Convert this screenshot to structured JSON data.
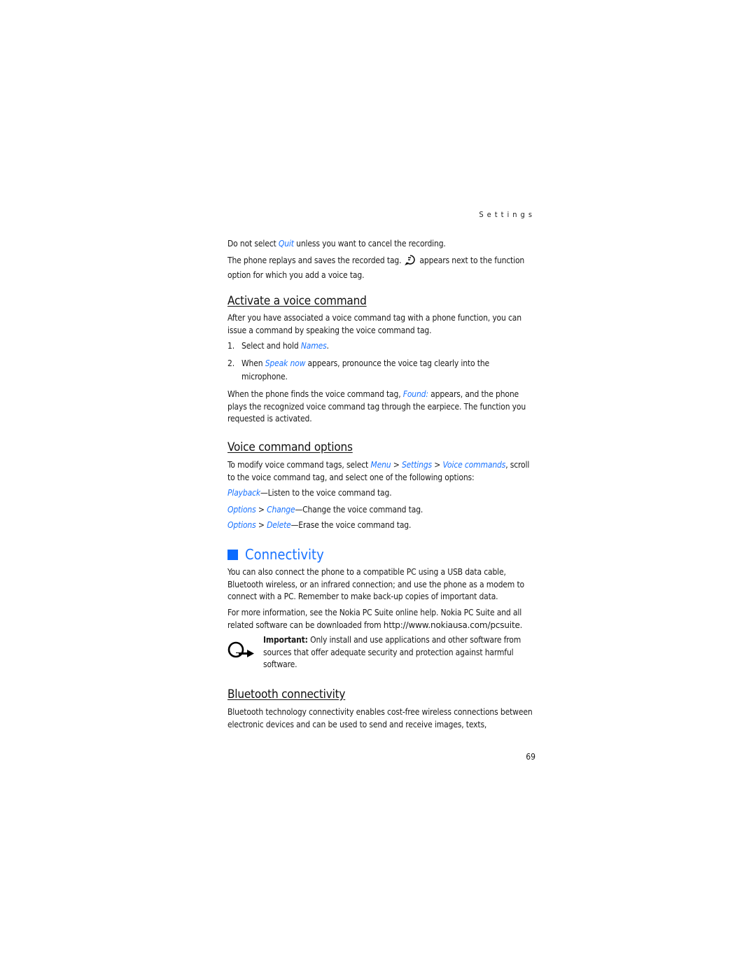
{
  "header": {
    "running_head": "Settings"
  },
  "intro": {
    "p1_a": "Do not select ",
    "p1_link": "Quit",
    "p1_b": " unless you want to cancel the recording.",
    "p2_a": "The phone replays and saves the recorded tag.",
    "p2_icon": "voice-tag-icon",
    "p2_b": "appears next to the function",
    "p2_c": "option for which you add a voice tag."
  },
  "activate": {
    "heading": "Activate a voice command",
    "p1": "After you have associated a voice command tag with a phone function, you can issue a command by speaking the voice command tag.",
    "steps": [
      {
        "num": "1.",
        "a": "Select and hold ",
        "link": "Names",
        "b": "."
      },
      {
        "num": "2.",
        "a": "When ",
        "link": "Speak now",
        "b": " appears, pronounce the voice tag clearly into the microphone."
      }
    ],
    "p2_a": "When the phone finds the voice command tag, ",
    "p2_link": "Found:",
    "p2_b": " appears, and the phone plays the recognized voice command tag through the earpiece. The function you requested is activated."
  },
  "options": {
    "heading": "Voice command options",
    "p1_a": "To modify voice command tags, select ",
    "menu": "Menu",
    "sep": " > ",
    "settings": "Settings",
    "voice_commands": "Voice commands",
    "p1_b": ", scroll to the voice command tag, and select one of the following options:",
    "items": [
      {
        "path": [
          "Playback"
        ],
        "desc": "—Listen to the voice command tag."
      },
      {
        "path": [
          "Options",
          "Change"
        ],
        "desc": "—Change the voice command tag."
      },
      {
        "path": [
          "Options",
          "Delete"
        ],
        "desc": "—Erase the voice command tag."
      }
    ]
  },
  "connectivity": {
    "heading": "Connectivity",
    "p1": "You can also connect the phone to a compatible PC using a USB data cable, Bluetooth wireless, or an infrared connection; and use the phone as a modem to connect with a PC. Remember to make back-up copies of important data.",
    "p2_a": "For more information, see the Nokia PC Suite online help. Nokia PC Suite and all related software can be downloaded from ",
    "p2_url": "http://www.nokiausa.com/pcsuite",
    "p2_b": ".",
    "note_icon": "important-note-icon",
    "note_label": "Important:",
    "note_text": " Only install and use applications and other software from sources that offer adequate security and protection against harmful software."
  },
  "bluetooth": {
    "heading": "Bluetooth connectivity",
    "p1": "Bluetooth technology connectivity enables cost-free wireless connections between electronic devices and can be used to send and receive images, texts,"
  },
  "footer": {
    "page_number": "69"
  },
  "colors": {
    "accent_blue": "#1a73ff",
    "text": "#1a1a1a"
  }
}
